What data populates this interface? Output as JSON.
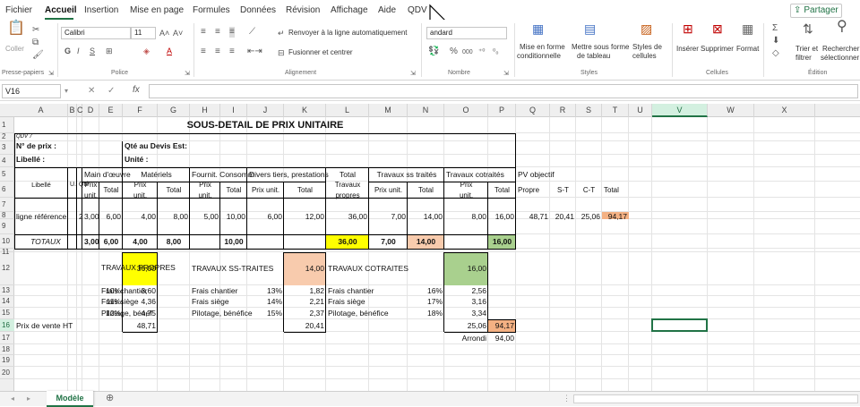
{
  "menu": {
    "tabs": [
      "Fichier",
      "Accueil",
      "Insertion",
      "Mise en page",
      "Formules",
      "Données",
      "Révision",
      "Affichage",
      "Aide",
      "QDV"
    ],
    "share": "Partager"
  },
  "ribbon": {
    "clipboard": {
      "paste": "Coller",
      "label": "Presse-papiers"
    },
    "font": {
      "name": "Calibri",
      "size": "11",
      "label": "Police"
    },
    "alignment": {
      "wrap": "Renvoyer à la ligne automatiquement",
      "merge": "Fusionner et centrer",
      "label": "Alignement"
    },
    "number": {
      "format": "andard",
      "percent": "%",
      "thousands": "000",
      "label": "Nombre"
    },
    "styles": {
      "cond": "Mise en forme",
      "cond2": "conditionnelle",
      "table": "Mettre sous forme",
      "table2": "de tableau",
      "cell": "Styles de",
      "cell2": "cellules",
      "label": "Styles"
    },
    "cells": {
      "insert": "Insérer",
      "delete": "Supprimer",
      "format": "Format",
      "label": "Cellules"
    },
    "editing": {
      "sort": "Trier et",
      "sort2": "filtrer",
      "find": "Rechercher",
      "find2": "sélectionner",
      "label": "Édition"
    }
  },
  "formula_bar": {
    "name_box": "V16",
    "fx": "fx",
    "value": ""
  },
  "columns": [
    "A",
    "B",
    "C",
    "D",
    "E",
    "F",
    "G",
    "H",
    "I",
    "J",
    "K",
    "L",
    "M",
    "N",
    "O",
    "P",
    "Q",
    "R",
    "S",
    "T",
    "U",
    "V",
    "W",
    "X"
  ],
  "rows": [
    "1",
    "2",
    "3",
    "4",
    "5",
    "6",
    "7",
    "8",
    "9",
    "10",
    "11",
    "12",
    "13",
    "14",
    "15",
    "16",
    "17",
    "18",
    "19",
    "20"
  ],
  "sheet": {
    "title": "SOUS-DETAIL DE PRIX UNITAIRE",
    "qdv": "QDV 7",
    "no_prix": "N° de prix :",
    "qte_devis": "Qté au Devis Est:",
    "libelle": "Libellé :",
    "unite": "Unité :",
    "h_main": "Main d'œuvre",
    "h_mat": "Matériels",
    "h_fourn": "Fournit. Consomm",
    "h_divers": "Divers tiers, prestations",
    "h_total": "Total",
    "h_tss": "Travaux ss traités",
    "h_tcot": "Travaux cotraités",
    "h_pv": "PV objectif",
    "sh_libelle": "Libellé",
    "sh_u": "U.",
    "sh_qte": "Qté",
    "sh_prix": "Prix",
    "sh_unit": "unit.",
    "sh_total": "Total",
    "sh_prixunit": "Prix unit.",
    "sh_travaux": "Travaux",
    "sh_propres": "propres",
    "sh_propre": "Propre",
    "sh_st": "S-T",
    "sh_ct": "C-T",
    "sh_total2": "Total",
    "ref": {
      "label": "ligne référence",
      "qte": "2",
      "d": "3,00",
      "e": "6,00",
      "f": "4,00",
      "g": "8,00",
      "h": "5,00",
      "i": "10,00",
      "j": "6,00",
      "k": "12,00",
      "l": "36,00",
      "m": "7,00",
      "n": "14,00",
      "o": "8,00",
      "p": "16,00",
      "q": "48,71",
      "r": "20,41",
      "s": "25,06",
      "t": "94,17"
    },
    "totaux": {
      "label": "TOTAUX",
      "d": "3,00",
      "e": "6,00",
      "f": "4,00",
      "g": "8,00",
      "i": "10,00",
      "l": "36,00",
      "m": "7,00",
      "n": "14,00",
      "p": "16,00"
    },
    "summary": {
      "tp": "TRAVAUX PROPRES",
      "tp_val": "36,00",
      "fc": "Frais chantier",
      "fc_pct": "10%",
      "fc_val": "3,60",
      "fs": "Frais siège",
      "fs_pct": "11%",
      "fs_val": "4,36",
      "pb": "Pilotage, bénéf",
      "pb_pct": "12%",
      "pb_val": "4,75",
      "pv": "Prix de vente HT",
      "pv_val": "48,71",
      "tst": "TRAVAUX SS-TRAITES",
      "tst_val": "14,00",
      "fc2": "Frais chantier",
      "fc2_pct": "13%",
      "fc2_val": "1,82",
      "fs2": "Frais siège",
      "fs2_pct": "14%",
      "fs2_val": "2,21",
      "pb2": "Pilotage, bénéfice",
      "pb2_pct": "15%",
      "pb2_val": "2,37",
      "st_total": "20,41",
      "tct": "TRAVAUX COTRAITES",
      "tct_val": "16,00",
      "fc3": "Frais chantier",
      "fc3_pct": "16%",
      "fc3_val": "2,56",
      "fs3": "Frais siège",
      "fs3_pct": "17%",
      "fs3_val": "3,16",
      "pb3": "Pilotage, bénéfice",
      "pb3_pct": "18%",
      "pb3_val": "3,34",
      "ct_total": "25,06",
      "grand": "94,17",
      "arrondi": "Arrondi",
      "arrondi_val": "94,00"
    }
  },
  "sheet_tab": "Modèle",
  "colors": {
    "accent": "#217346",
    "yellow": "#ffff00",
    "peach": "#f8cbad",
    "green": "#a9d08e",
    "orange": "#f4b183"
  }
}
